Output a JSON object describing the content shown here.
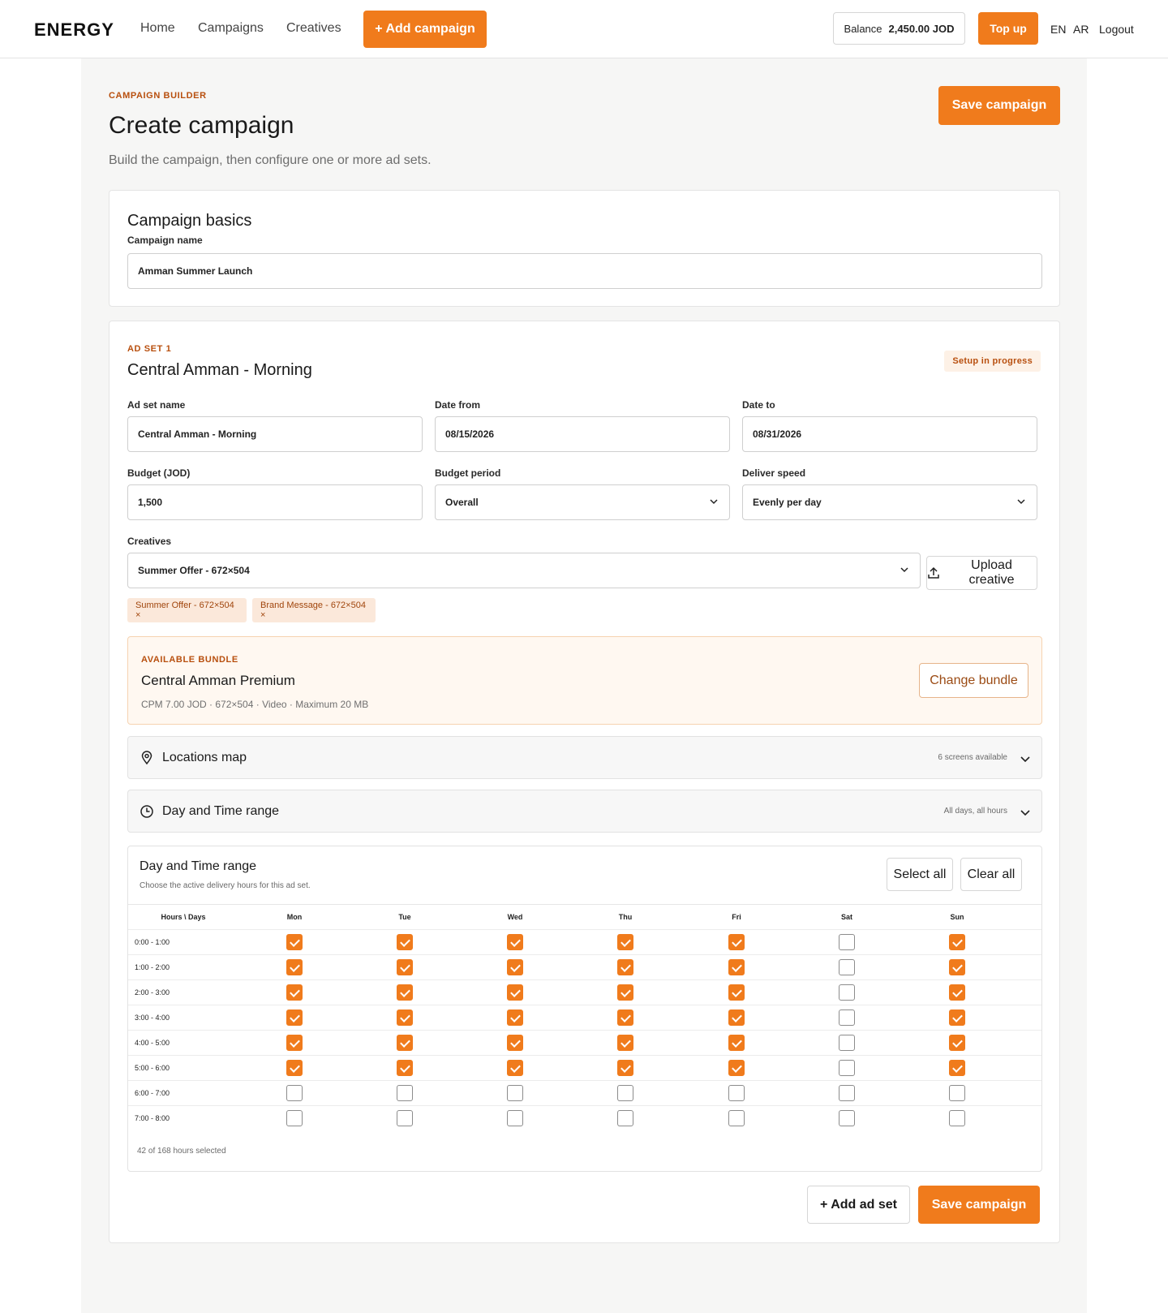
{
  "nav": {
    "logo": "ENERGY",
    "links": [
      "Home",
      "Campaigns",
      "Creatives"
    ],
    "add_campaign": "+ Add campaign",
    "balance_label": "Balance",
    "balance_value": "2,450.00 JOD",
    "top_up": "Top up",
    "lang_en": "EN",
    "lang_ar": "AR",
    "logout": "Logout"
  },
  "header": {
    "eyebrow": "CAMPAIGN BUILDER",
    "title": "Create campaign",
    "subtitle": "Build the campaign, then configure one or more ad sets.",
    "save_label": "Save campaign"
  },
  "basics": {
    "heading": "Campaign basics",
    "name_label": "Campaign name",
    "name_value": "Amman Summer Launch"
  },
  "adset": {
    "eyebrow": "AD SET 1",
    "title": "Central Amman - Morning",
    "status": "Setup in progress",
    "name_label": "Ad set name",
    "name_value": "Central Amman - Morning",
    "date_from_label": "Date from",
    "date_from_value": "08/15/2026",
    "date_to_label": "Date to",
    "date_to_value": "08/31/2026",
    "budget_label": "Budget (JOD)",
    "budget_value": "1,500",
    "budget_period_label": "Budget period",
    "budget_period_value": "Overall",
    "deliver_speed_label": "Deliver speed",
    "deliver_speed_value": "Evenly per day",
    "creatives_label": "Creatives",
    "creatives_value": "Summer Offer - 672×504",
    "upload_label": "Upload creative",
    "chips": [
      "Summer Offer - 672×504 ×",
      "Brand Message - 672×504 ×"
    ],
    "bundle": {
      "eyebrow": "AVAILABLE BUNDLE",
      "name": "Central Amman Premium",
      "meta": "CPM 7.00 JOD · 672×504 · Video · Maximum 20 MB",
      "change_label": "Change bundle"
    },
    "locations": {
      "title": "Locations map",
      "meta": "6 screens available"
    },
    "daytime": {
      "title": "Day and Time range",
      "meta": "All days, all hours"
    },
    "schedule": {
      "title": "Day and Time range",
      "subtitle": "Choose the active delivery hours for this ad set.",
      "select_all": "Select all",
      "clear_all": "Clear all",
      "corner_header": "Hours \\ Days",
      "days": [
        "Mon",
        "Tue",
        "Wed",
        "Thu",
        "Fri",
        "Sat",
        "Sun"
      ],
      "hours": [
        "0:00 - 1:00",
        "1:00 - 2:00",
        "2:00 - 3:00",
        "3:00 - 4:00",
        "4:00 - 5:00",
        "5:00 - 6:00",
        "6:00 - 7:00",
        "7:00 - 8:00"
      ],
      "grid": [
        [
          true,
          true,
          true,
          true,
          true,
          false,
          true
        ],
        [
          true,
          true,
          true,
          true,
          true,
          false,
          true
        ],
        [
          true,
          true,
          true,
          true,
          true,
          false,
          true
        ],
        [
          true,
          true,
          true,
          true,
          true,
          false,
          true
        ],
        [
          true,
          true,
          true,
          true,
          true,
          false,
          true
        ],
        [
          true,
          true,
          true,
          true,
          true,
          false,
          true
        ],
        [
          false,
          false,
          false,
          false,
          false,
          false,
          false
        ],
        [
          false,
          false,
          false,
          false,
          false,
          false,
          false
        ]
      ],
      "summary": "42 of 168 hours selected"
    },
    "add_adset": "+ Add ad set",
    "save_label": "Save campaign"
  },
  "colors": {
    "accent": "#f07b1c",
    "accent_dark": "#b84f0e",
    "bundle_bg": "#fff8f1",
    "chip_bg": "#fbe8da"
  },
  "icons": [
    "chevron-down-icon",
    "upload-icon",
    "map-pin-icon",
    "clock-icon",
    "checkmark-icon"
  ]
}
